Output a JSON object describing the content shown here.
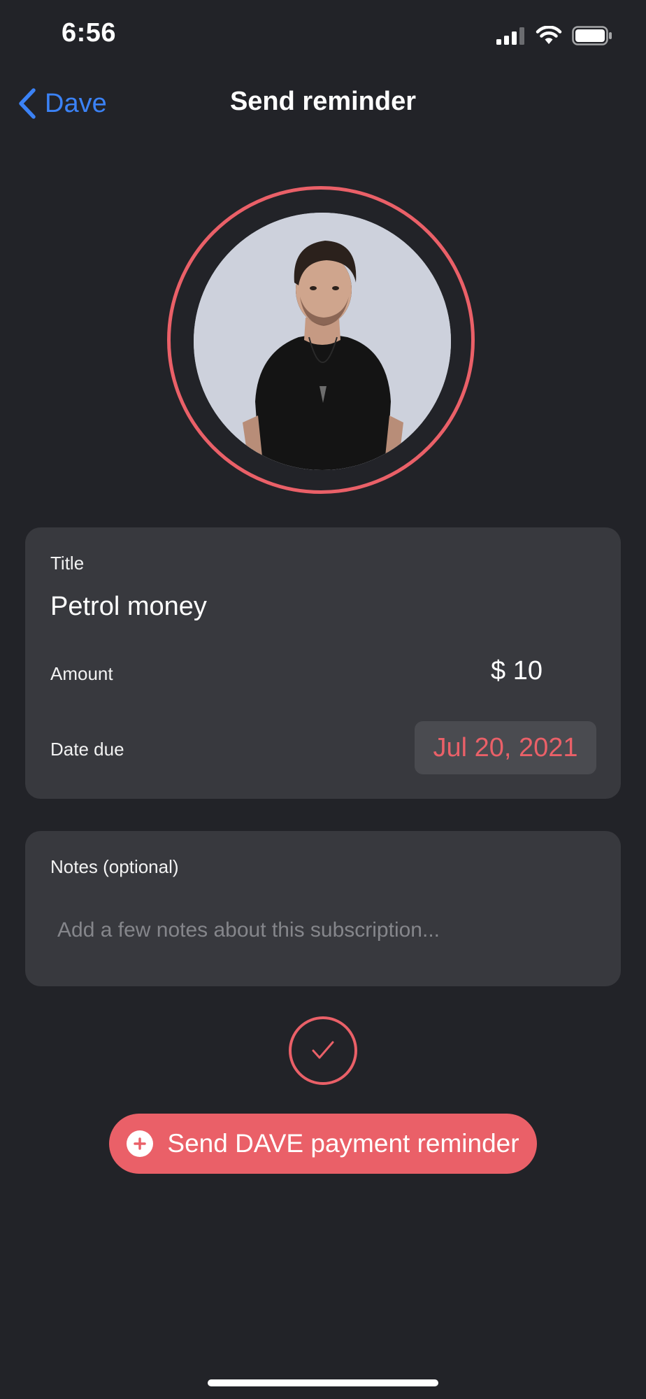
{
  "status_bar": {
    "time": "6:56",
    "icons": [
      "signal-icon",
      "wifi-icon",
      "battery-icon"
    ]
  },
  "nav": {
    "back_label": "Dave",
    "title": "Send reminder"
  },
  "avatar": {
    "alt": "Dave"
  },
  "details": {
    "title_label": "Title",
    "title_value": "Petrol money",
    "amount_label": "Amount",
    "amount_value": "$ 10",
    "date_label": "Date due",
    "date_value": "Jul 20, 2021"
  },
  "notes": {
    "label": "Notes (optional)",
    "placeholder": "Add a few notes about this subscription..."
  },
  "actions": {
    "send_label": "Send DAVE payment reminder"
  },
  "colors": {
    "accent": "#ea6068",
    "link": "#3b82f6",
    "background": "#222328",
    "card": "#38393e"
  }
}
